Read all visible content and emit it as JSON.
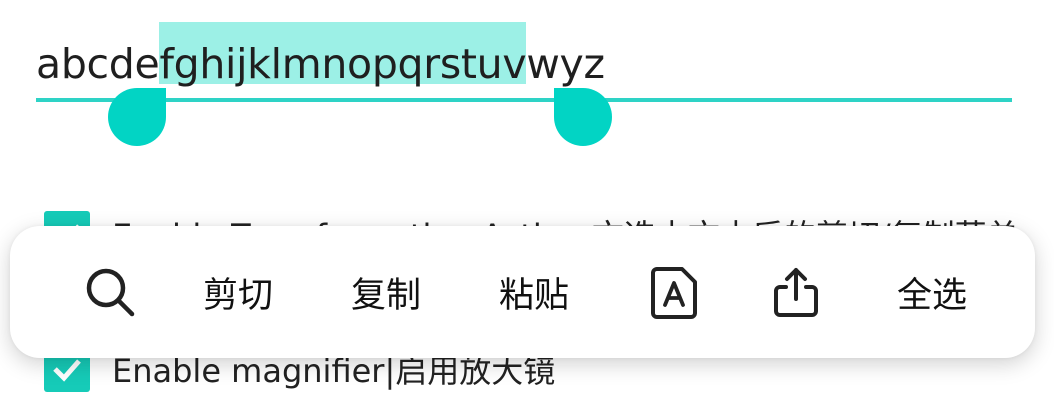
{
  "text_field": {
    "before": "abcde",
    "selected": "fghijklmnopqrstuv",
    "after": "wyz"
  },
  "options": [
    {
      "label": "Enable Transformation Action 文选中文本后的剪切/复制菜单",
      "checked": true
    },
    {
      "label": "Enable magnifier|启用放大镜",
      "checked": true
    }
  ],
  "toolbar": {
    "cut": "剪切",
    "copy": "复制",
    "paste": "粘贴",
    "select_all": "全选",
    "icons": [
      "search-icon",
      "translate-icon",
      "share-icon"
    ]
  },
  "colors": {
    "accent": "#02d4c4",
    "selection": "#9cf0e6",
    "checkbox": "#16cbb8"
  }
}
